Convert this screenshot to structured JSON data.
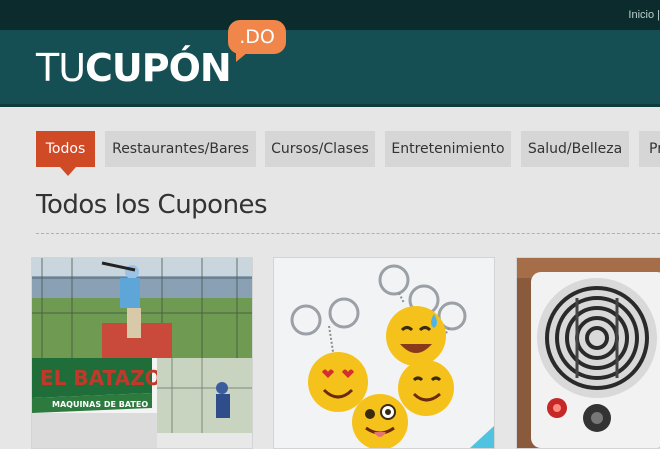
{
  "topbar": {
    "link_inicio": "Inicio",
    "separator": "|"
  },
  "logo": {
    "text_light": "TU",
    "text_bold": "CUPÓN",
    "badge": ".DO"
  },
  "tabs": [
    {
      "label": "Todos",
      "active": true
    },
    {
      "label": "Restaurantes/Bares",
      "active": false
    },
    {
      "label": "Cursos/Clases",
      "active": false
    },
    {
      "label": "Entretenimiento",
      "active": false
    },
    {
      "label": "Salud/Belleza",
      "active": false
    },
    {
      "label": "Pr",
      "active": false
    }
  ],
  "page_title": "Todos los Cupones",
  "cards": [
    {
      "image": "baseball batting cages photo",
      "banner_text": "EL BATAZO",
      "banner_subtext": "MAQUINAS DE BATEO"
    },
    {
      "image": "emoji keychains photo"
    },
    {
      "image": "electric hot plate photo"
    }
  ],
  "colors": {
    "topbar": "#0b2b2c",
    "header": "#164f53",
    "accent": "#d14a26",
    "badge": "#f0864a",
    "page_bg": "#e6e6e6"
  }
}
